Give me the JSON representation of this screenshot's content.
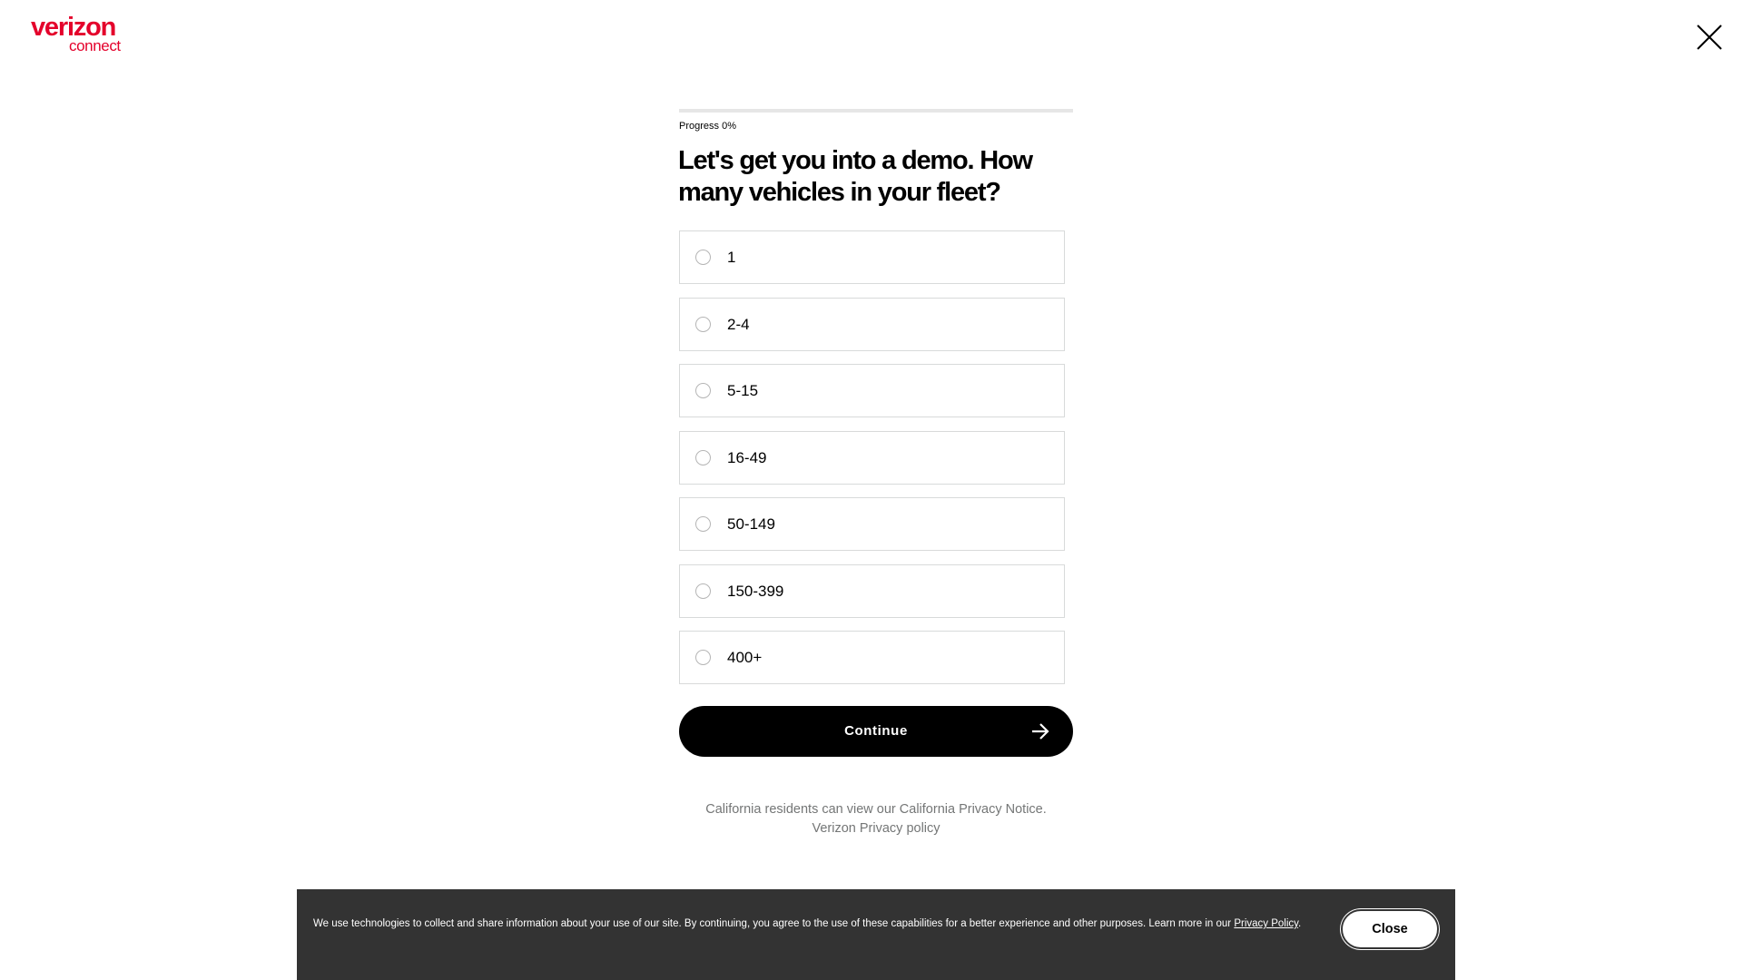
{
  "brand": {
    "name": "verizon",
    "subname": "connect",
    "color": "#e4002b"
  },
  "header": {
    "close_icon": "close-icon"
  },
  "progress": {
    "label": "Progress 0%",
    "value": 0
  },
  "question": "Let's get you into a demo. How many vehicles in your fleet?",
  "options": [
    {
      "label": "1"
    },
    {
      "label": "2-4"
    },
    {
      "label": "5-15"
    },
    {
      "label": "16-49"
    },
    {
      "label": "50-149"
    },
    {
      "label": "150-399"
    },
    {
      "label": "400+"
    }
  ],
  "continue": {
    "label": "Continue",
    "icon": "arrow-right-icon"
  },
  "privacy": {
    "california": "California residents can view our California Privacy Notice.",
    "policy": "Verizon Privacy policy"
  },
  "cookie_banner": {
    "text": "We use technologies to collect and share information about your use of our site. By continuing, you agree to the use of these capabilities for a better experience and other purposes. Learn more in our ",
    "link": "Privacy Policy",
    "suffix": ".",
    "close_label": "Close",
    "background": "#333333"
  }
}
